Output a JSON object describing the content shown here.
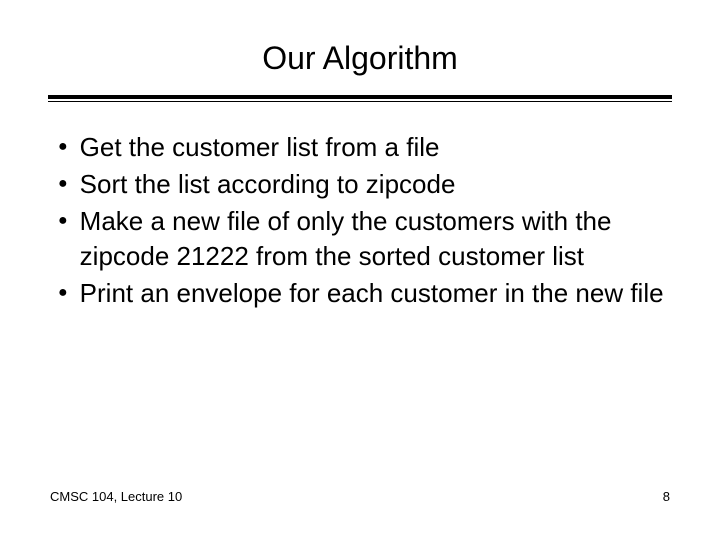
{
  "title": "Our Algorithm",
  "bullets": {
    "b0": "Get the customer list from a file",
    "b1": "Sort the list according to zipcode",
    "b2": "Make a new file of only the customers with the zipcode 21222 from the sorted customer list",
    "b3": "Print an envelope for each customer in the new file"
  },
  "footer": {
    "left": "CMSC 104, Lecture 10",
    "right": "8"
  }
}
